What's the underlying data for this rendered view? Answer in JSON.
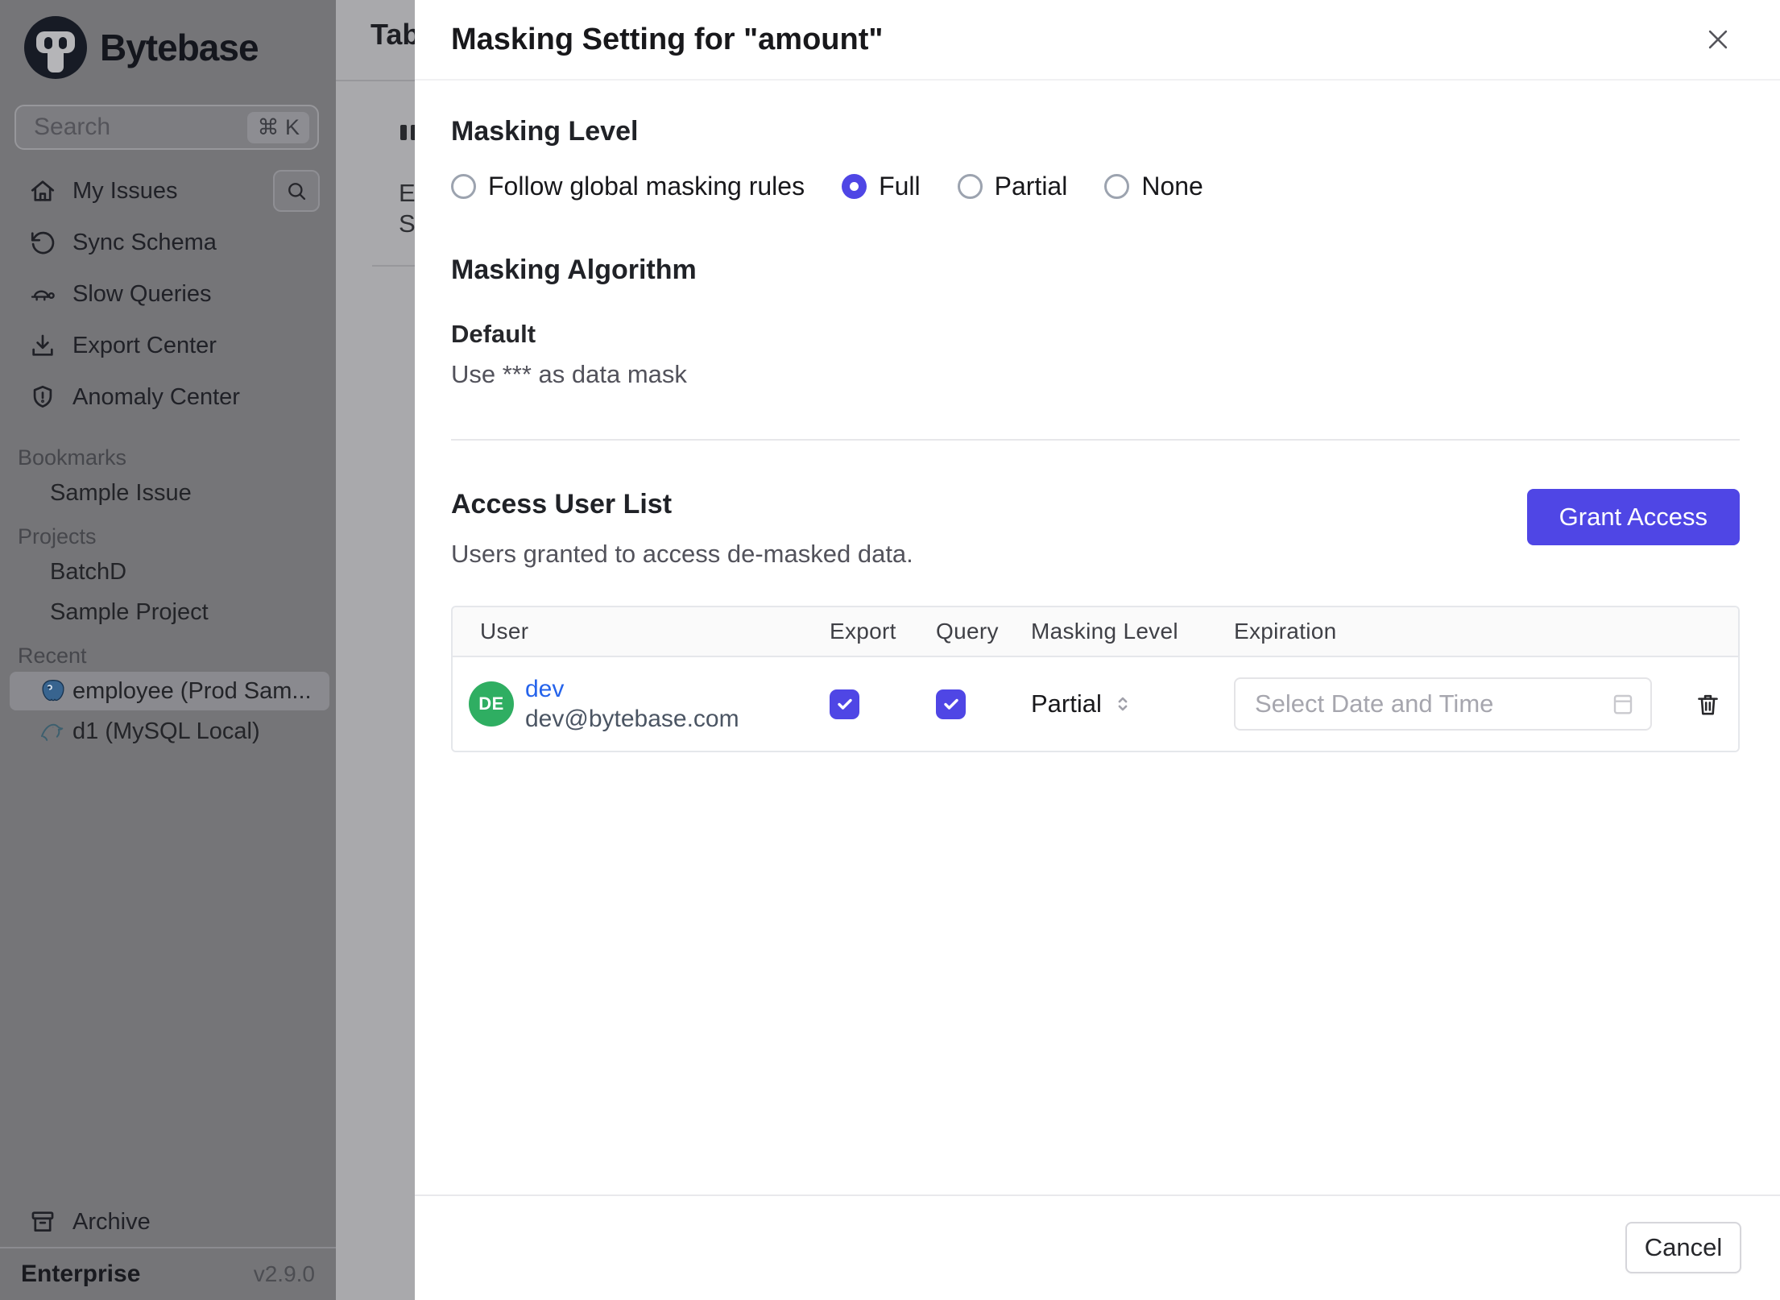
{
  "app": {
    "logo_text": "Bytebase",
    "plan": "Enterprise",
    "version": "v2.9.0"
  },
  "sidebar": {
    "search": {
      "placeholder": "Search",
      "shortcut_keys": "⌘ K"
    },
    "nav_items": [
      {
        "label": "My Issues",
        "icon": "home-icon"
      },
      {
        "label": "Sync Schema",
        "icon": "sync-icon"
      },
      {
        "label": "Slow Queries",
        "icon": "turtle-icon"
      },
      {
        "label": "Export Center",
        "icon": "download-icon"
      },
      {
        "label": "Anomaly Center",
        "icon": "shield-icon"
      }
    ],
    "sections": [
      {
        "header": "Bookmarks",
        "items": [
          {
            "label": "Sample Issue"
          }
        ]
      },
      {
        "header": "Projects",
        "items": [
          {
            "label": "BatchD"
          },
          {
            "label": "Sample Project"
          }
        ]
      },
      {
        "header": "Recent",
        "items": [
          {
            "label": "employee (Prod Sam...",
            "icon": "postgresql-icon",
            "active": true
          },
          {
            "label": "d1 (MySQL Local)",
            "icon": "mysql-icon",
            "active": false
          }
        ]
      }
    ],
    "archive_label": "Archive"
  },
  "background_page": {
    "fragments": {
      "tab": "Tab",
      "line1": "E",
      "line2": "S"
    }
  },
  "modal": {
    "title": "Masking Setting for \"amount\"",
    "masking_level": {
      "heading": "Masking Level",
      "options": [
        {
          "label": "Follow global masking rules",
          "selected": false
        },
        {
          "label": "Full",
          "selected": true
        },
        {
          "label": "Partial",
          "selected": false
        },
        {
          "label": "None",
          "selected": false
        }
      ]
    },
    "masking_algorithm": {
      "heading": "Masking Algorithm",
      "name": "Default",
      "description": "Use *** as data mask"
    },
    "access_user_list": {
      "heading": "Access User List",
      "subtitle": "Users granted to access de-masked data.",
      "grant_button": "Grant Access",
      "table": {
        "columns": [
          "User",
          "Export",
          "Query",
          "Masking Level",
          "Expiration"
        ],
        "rows": [
          {
            "user_initials": "DE",
            "user_name": "dev",
            "user_email": "dev@bytebase.com",
            "export": true,
            "query": true,
            "masking_level": "Partial",
            "expiration_placeholder": "Select Date and Time"
          }
        ]
      }
    },
    "cancel_button": "Cancel"
  },
  "colors": {
    "accent": "#4f46e5",
    "avatar_green": "#2fae62",
    "link_blue": "#2563eb"
  }
}
